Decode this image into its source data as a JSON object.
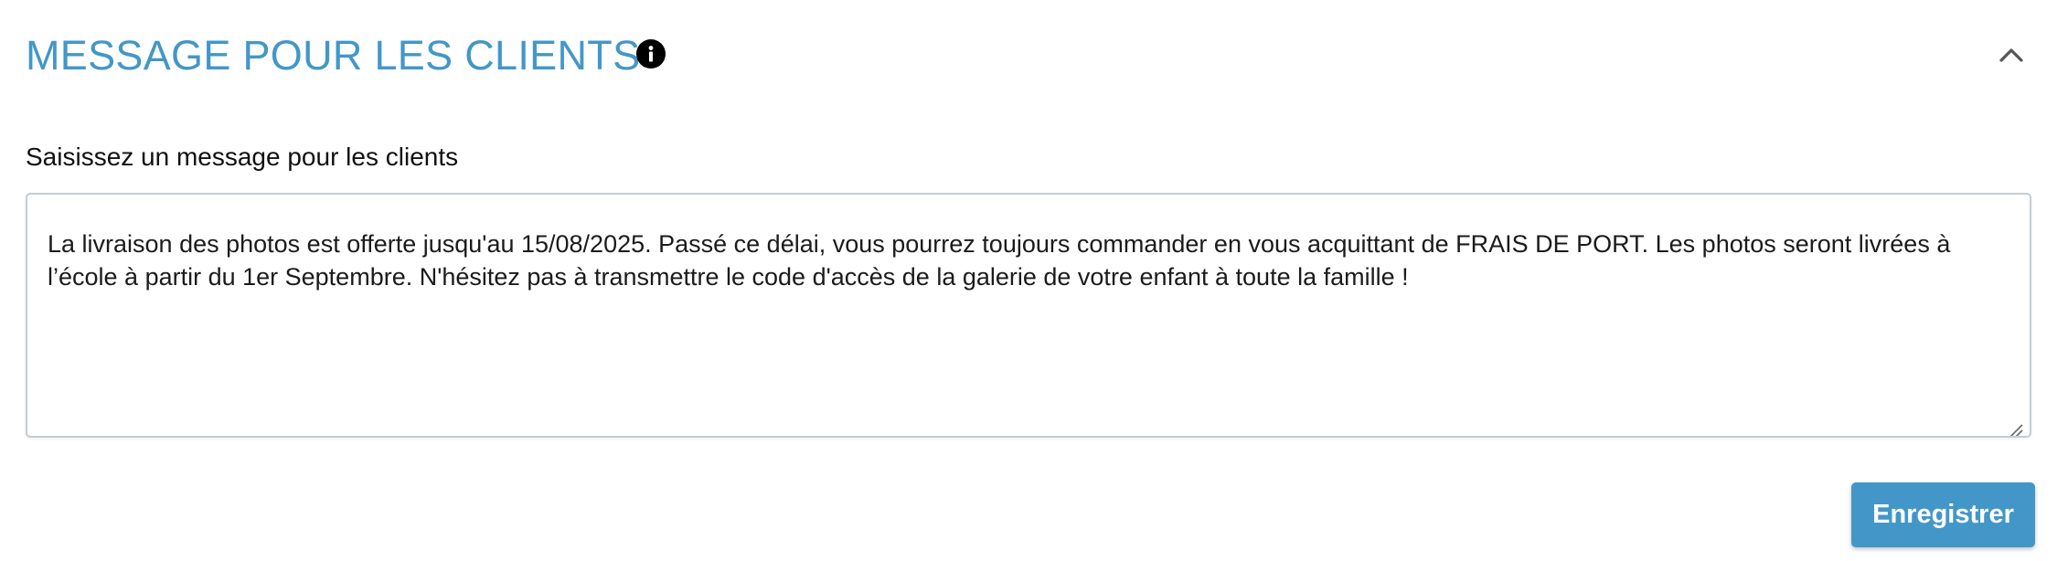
{
  "section": {
    "title": "MESSAGE POUR LES CLIENTS",
    "info_icon": "info-icon",
    "collapse_icon": "chevron-up-icon",
    "accent_color": "#4397c8"
  },
  "message_field": {
    "label": "Saisissez un message pour les clients",
    "value": "La livraison des photos est offerte jusqu'au 15/08/2025. Passé ce délai, vous pourrez toujours commander en vous acquittant de FRAIS DE PORT. Les photos seront livrées à l’école à partir du 1er Septembre. N'hésitez pas à transmettre le code d'accès de la galerie de votre enfant à toute la famille !"
  },
  "actions": {
    "save_label": "Enregistrer"
  }
}
